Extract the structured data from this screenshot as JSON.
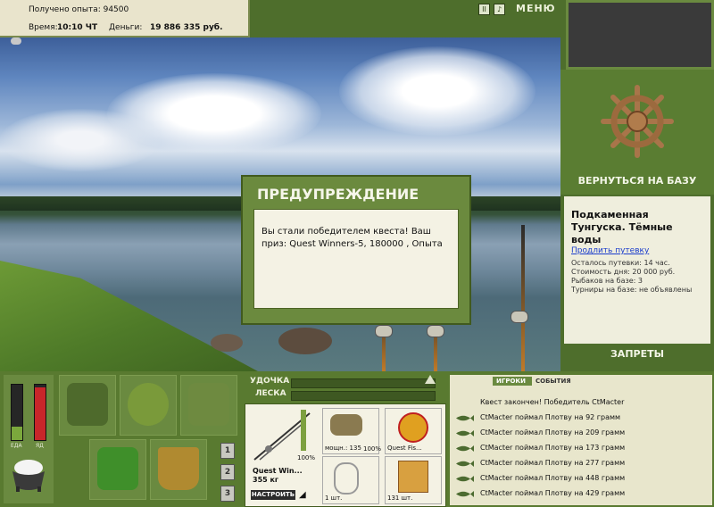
{
  "status": {
    "experience_text": "Получено опыта: 94500",
    "time_label": "Время:",
    "time_value": "10:10 ЧТ",
    "money_label": "Деньги:",
    "money_value": "19 886 335 руб."
  },
  "topbar": {
    "menu_label": "МЕНЮ",
    "pause_icon": "pause-icon",
    "sound_icon": "sound-icon"
  },
  "dialog": {
    "title": "ПРЕДУПРЕЖДЕНИЕ",
    "message": "Вы стали победителем квеста! Ваш приз: Quest Winners-5, 180000 , Опыта"
  },
  "right_panel": {
    "return_button": "ВЕРНУТЬСЯ НА БАЗУ",
    "location_title": "Подкаменная Тунгуска. Тёмные воды",
    "extend_link": "Продлить путевку",
    "trip_left": "Осталось путевки: 14 час.",
    "day_cost": "Стоимость дня: 20 000 руб.",
    "anglers": "Рыбаков на базе: 3",
    "tournaments": "Турниры на базе: не объявлены",
    "bans_button": "ЗАПРЕТЫ"
  },
  "meters": {
    "left_label": "ЕДА",
    "right_label": "ЯД",
    "food_level": 0.25,
    "poison_level": 0.95
  },
  "inventory": {
    "pages": [
      "1",
      "2",
      "3"
    ]
  },
  "rod_controls": {
    "rod_label": "УДОЧКА",
    "line_label": "ЛЕСКА"
  },
  "tackle": {
    "rod_name": "Quest Win...",
    "rod_weight": "355 кг",
    "rod_percent": "100%",
    "reel_label": "мощн.: 135",
    "reel_percent": "100%",
    "line_label": "Quest Fis...",
    "hook_count": "1 шт.",
    "bait_count": "131 шт.",
    "adjust_button": "НАСТРОИТЬ"
  },
  "feed": {
    "tab_players": "ИГРОКИ",
    "tab_events": "СОБЫТИЯ",
    "messages": [
      "Квест закончен! Победитель CtMacter",
      "CtMacter поймал Плотву на 92 грамм",
      "CtMacter поймал Плотву на 209 грамм",
      "CtMacter поймал Плотву на 173 грамм",
      "CtMacter поймал Плотву на 277 грамм",
      "CtMacter поймал Плотву на 448 грамм",
      "CtMacter поймал Плотву на 429 грамм"
    ]
  },
  "colors": {
    "panel_green": "#597a30",
    "panel_light": "#efeedd",
    "accent_dark": "#415a1e"
  }
}
